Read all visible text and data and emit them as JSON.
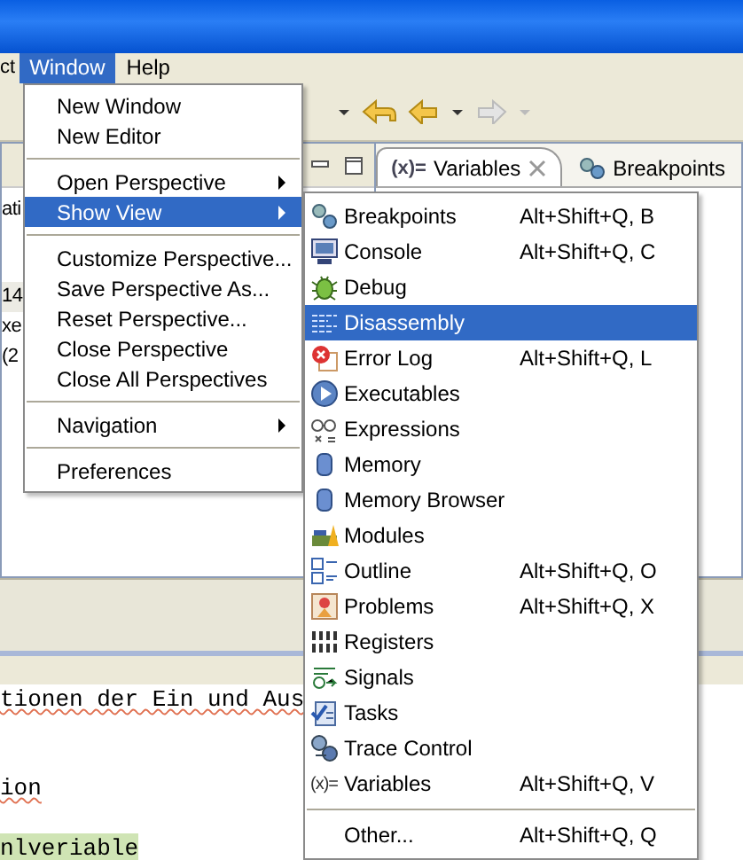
{
  "menubar": [
    {
      "label": "ct",
      "selected": false
    },
    {
      "label": "Window",
      "selected": true
    },
    {
      "label": "Help",
      "selected": false
    }
  ],
  "view_tabs": [
    {
      "label": "Variables",
      "icon_text": "(x)=",
      "selected": true,
      "closable": true
    },
    {
      "label": "Breakpoints",
      "selected": false,
      "closable": false
    }
  ],
  "left_panel": {
    "lines": [
      {
        "text": "ati",
        "highlighted": false
      },
      {
        "text": "14",
        "highlighted": true
      },
      {
        "text": "xe",
        "highlighted": false
      },
      {
        "text": "(2",
        "highlighted": false
      }
    ]
  },
  "editor": {
    "lines": [
      {
        "text": "tionen der Ein und Aus",
        "spellcheck": true,
        "highlighted": false
      },
      {
        "text": "ion",
        "spellcheck": true,
        "highlighted": false
      },
      {
        "text": "nlveriable",
        "spellcheck": false,
        "highlighted": true
      }
    ]
  },
  "window_menu": [
    {
      "kind": "item",
      "label": "New Window",
      "submenu": false,
      "selected": false
    },
    {
      "kind": "item",
      "label": "New Editor",
      "submenu": false,
      "selected": false
    },
    {
      "kind": "separator"
    },
    {
      "kind": "item",
      "label": "Open Perspective",
      "submenu": true,
      "selected": false
    },
    {
      "kind": "item",
      "label": "Show View",
      "submenu": true,
      "selected": true
    },
    {
      "kind": "separator"
    },
    {
      "kind": "item",
      "label": "Customize Perspective...",
      "submenu": false,
      "selected": false
    },
    {
      "kind": "item",
      "label": "Save Perspective As...",
      "submenu": false,
      "selected": false
    },
    {
      "kind": "item",
      "label": "Reset Perspective...",
      "submenu": false,
      "selected": false
    },
    {
      "kind": "item",
      "label": "Close Perspective",
      "submenu": false,
      "selected": false
    },
    {
      "kind": "item",
      "label": "Close All Perspectives",
      "submenu": false,
      "selected": false
    },
    {
      "kind": "separator"
    },
    {
      "kind": "item",
      "label": "Navigation",
      "submenu": true,
      "selected": false
    },
    {
      "kind": "separator"
    },
    {
      "kind": "item",
      "label": "Preferences",
      "submenu": false,
      "selected": false
    }
  ],
  "show_view_menu": [
    {
      "kind": "item",
      "label": "Breakpoints",
      "shortcut": "Alt+Shift+Q, B",
      "selected": false
    },
    {
      "kind": "item",
      "label": "Console",
      "shortcut": "Alt+Shift+Q, C",
      "selected": false
    },
    {
      "kind": "item",
      "label": "Debug",
      "selected": false
    },
    {
      "kind": "item",
      "label": "Disassembly",
      "selected": true
    },
    {
      "kind": "item",
      "label": "Error Log",
      "shortcut": "Alt+Shift+Q, L",
      "selected": false
    },
    {
      "kind": "item",
      "label": "Executables",
      "selected": false
    },
    {
      "kind": "item",
      "label": "Expressions",
      "selected": false
    },
    {
      "kind": "item",
      "label": "Memory",
      "selected": false
    },
    {
      "kind": "item",
      "label": "Memory Browser",
      "selected": false
    },
    {
      "kind": "item",
      "label": "Modules",
      "selected": false
    },
    {
      "kind": "item",
      "label": "Outline",
      "shortcut": "Alt+Shift+Q, O",
      "selected": false
    },
    {
      "kind": "item",
      "label": "Problems",
      "shortcut": "Alt+Shift+Q, X",
      "selected": false
    },
    {
      "kind": "item",
      "label": "Registers",
      "selected": false
    },
    {
      "kind": "item",
      "label": "Signals",
      "selected": false
    },
    {
      "kind": "item",
      "label": "Tasks",
      "selected": false
    },
    {
      "kind": "item",
      "label": "Trace Control",
      "selected": false
    },
    {
      "kind": "item",
      "label": "Variables",
      "icon_text": "(x)=",
      "shortcut": "Alt+Shift+Q, V",
      "selected": false
    },
    {
      "kind": "separator"
    },
    {
      "kind": "item",
      "label": "Other...",
      "shortcut": "Alt+Shift+Q, Q",
      "selected": false
    }
  ]
}
